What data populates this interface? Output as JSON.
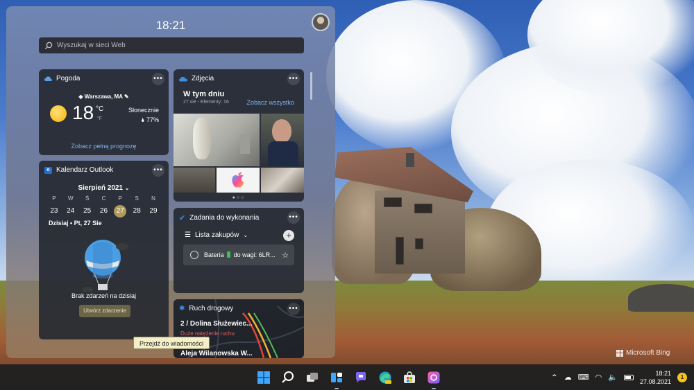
{
  "board": {
    "time": "18:21",
    "search_placeholder": "Wyszukaj w sieci Web"
  },
  "weather": {
    "title": "Pogoda",
    "location": "Warszawa, MA",
    "temperature": "18",
    "unit_c": "°C",
    "unit_f": "°F",
    "condition": "Słonecznie",
    "humidity": "77%",
    "forecast_link": "Zobacz pełną prognozę"
  },
  "photos": {
    "title": "Zdjęcia",
    "heading": "W tym dniu",
    "subtitle": "27 sie - Elementy: 16",
    "see_all": "Zobacz wszystko"
  },
  "calendar": {
    "title": "Kalendarz Outlook",
    "month": "Sierpień 2021",
    "day_names": [
      "P",
      "W",
      "Ś",
      "C",
      "P",
      "S",
      "N"
    ],
    "dates": [
      "23",
      "24",
      "25",
      "26",
      "27",
      "28",
      "29"
    ],
    "today_label": "Dzisiaj • Pt, 27 Sie",
    "empty_text": "Brak zdarzeń na dzisiaj",
    "create_button": "Utwórz zdarzenie"
  },
  "tasks": {
    "title": "Zadania do wykonania",
    "list_name": "Lista zakupów",
    "item_before": "Bateria",
    "item_after": "do wagi: 6LR..."
  },
  "traffic": {
    "title": "Ruch drogowy",
    "route": "2 / Dolina Służewiec...",
    "status": "Duże natężenie ruchu",
    "street": "Aleja Wilanowska W..."
  },
  "tooltip": "Przejdź do wiadomości",
  "wallpaper": {
    "bing_label": "Microsoft Bing"
  },
  "taskbar": {
    "icons": [
      "start-icon",
      "search-icon",
      "task-view-icon",
      "widgets-icon",
      "teams-chat-icon",
      "edge-canary-icon",
      "store-icon",
      "photos-app-icon"
    ],
    "clock_time": "18:21",
    "clock_date": "27.08.2021",
    "notification_count": "1"
  },
  "colors": {
    "accent": "#7fb3ea",
    "today": "#b29a58",
    "traffic_alert": "#e26060"
  }
}
